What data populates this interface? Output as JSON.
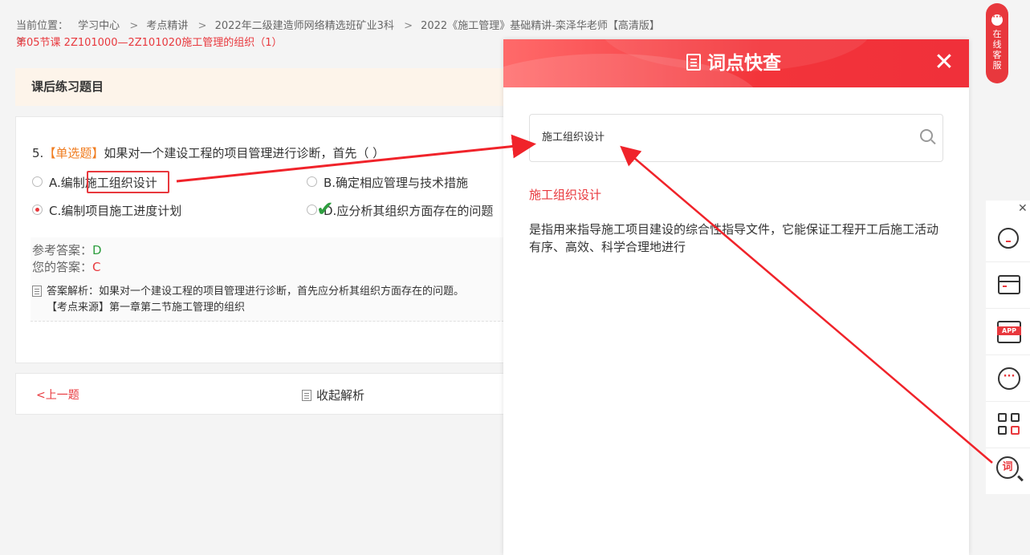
{
  "breadcrumb": {
    "prefix": "当前位置：",
    "items": [
      "学习中心",
      "考点精讲",
      "2022年二级建造师网络精选班矿业3科",
      "2022《施工管理》基础精讲-栾泽华老师【高清版】"
    ],
    "separator": ">",
    "current": "第05节课 2Z101000—2Z101020施工管理的组织（1）"
  },
  "section_title": "课后练习题目",
  "question": {
    "number": "5.",
    "type": "【单选题】",
    "text": "如果对一个建设工程的项目管理进行诊断，首先（ ）",
    "options": [
      {
        "label": "A.编制施工组织设计"
      },
      {
        "label": "B.确定相应管理与技术措施"
      },
      {
        "label": "C.编制项目施工进度计划"
      },
      {
        "label": "D.应分析其组织方面存在的问题"
      }
    ],
    "selected_option": "C"
  },
  "answer": {
    "reference_label": "参考答案：",
    "reference_value": "D",
    "yours_label": "您的答案：",
    "yours_value": "C",
    "analysis_line1": "答案解析：如果对一个建设工程的项目管理进行诊断，首先应分析其组织方面存在的问题。",
    "analysis_line2": "【考点来源】第一章第二节施工管理的组织"
  },
  "footer": {
    "prev_label": "<上一题",
    "collapse_label": "收起解析"
  },
  "lookup_panel": {
    "title": "词点快查",
    "search_value": "施工组织设计",
    "result_term": "施工组织设计",
    "result_definition": "是指用来指导施工项目建设的综合性指导文件，它能保证工程开工后施工活动有序、高效、科学合理地进行"
  },
  "online_service": {
    "label": [
      "在",
      "线",
      "客",
      "服"
    ]
  },
  "side_toolbar": {
    "app_tag": "APP",
    "word_tag": "词"
  },
  "colors": {
    "accent": "#e8383d",
    "correct": "#2e9e3f",
    "question_type": "#f07c1f",
    "header_bg": "#fdf4ea"
  }
}
